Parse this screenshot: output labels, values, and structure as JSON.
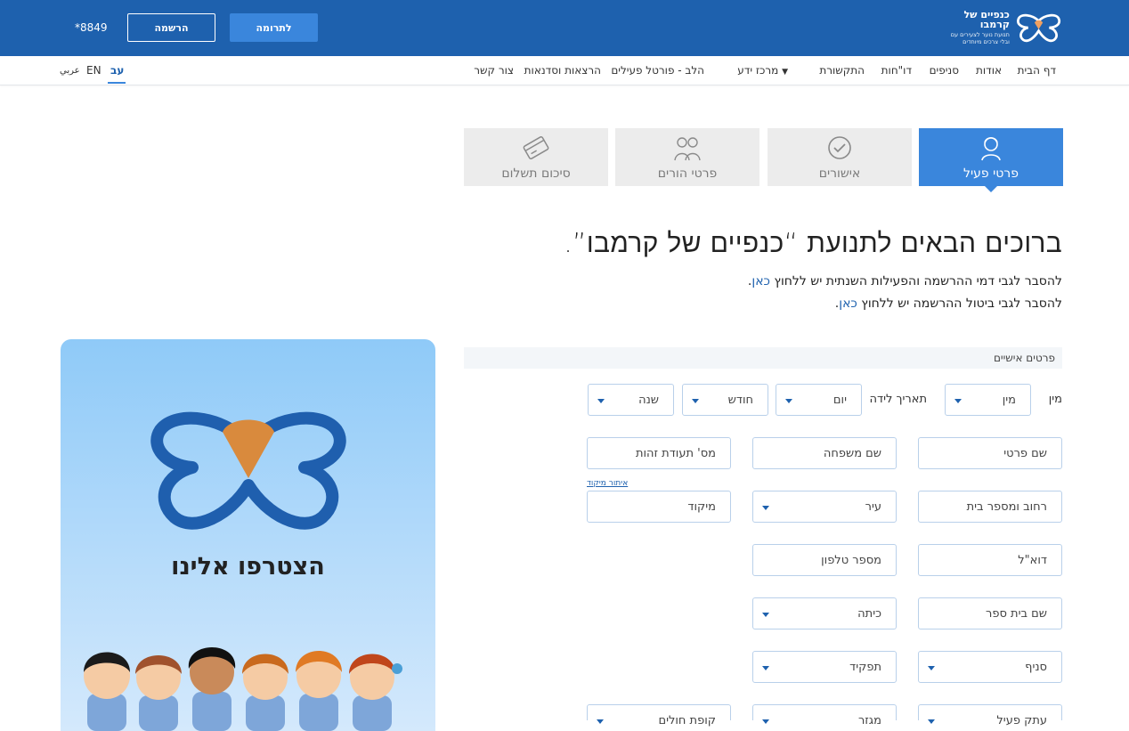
{
  "header": {
    "logo": {
      "name": "כנפיים של קרמבו",
      "tagline_1": "תנועת נוער לצעירים עם",
      "tagline_2": "ובלי צרכים מיוחדים"
    },
    "donate_label": "לתרומה",
    "register_label": "הרשמה",
    "phone": "*8849",
    "brand_color": "#1e61ae",
    "accent_color": "#3a86dc"
  },
  "nav": {
    "items": [
      "דף הבית",
      "אודות",
      "סניפים",
      "דו\"חות",
      "התקשורת",
      "מרכז ידע",
      "הלב - פורטל פעילים",
      "הרצאות וסדנאות",
      "צור קשר"
    ],
    "knowledge_caret": "▼",
    "languages": [
      "עב",
      "EN",
      "عربي"
    ]
  },
  "steps": [
    {
      "label": "פרטי פעיל",
      "icon": "person-icon",
      "active": true
    },
    {
      "label": "אישורים",
      "icon": "checkmark-icon",
      "active": false
    },
    {
      "label": "פרטי הורים",
      "icon": "parents-icon",
      "active": false
    },
    {
      "label": "סיכום תשלום",
      "icon": "credit-card-icon",
      "active": false
    }
  ],
  "welcome": {
    "title": "ברוכים הבאים לתנועת “כנפיים של קרמבו”.",
    "line1_text": "להסבר לגבי דמי ההרשמה והפעילות השנתית יש ללחוץ ",
    "line1_link": "כאן",
    "line2_text": "להסבר לגבי ביטול ההרשמה יש ללחוץ ",
    "line2_link": "כאן",
    "dot": "."
  },
  "panel": {
    "title": "הצטרפו אלינו"
  },
  "form": {
    "section_title": "פרטים אישיים",
    "gender_label": "מין",
    "gender_select": "מין",
    "birth_label": "תאריך לידה",
    "day": "יום",
    "month": "חודש",
    "year": "שנה",
    "first_name": "שם פרטי",
    "last_name": "שם משפחה",
    "id_number": "מס' תעודת זהות",
    "street": "רחוב ומספר בית",
    "city": "עיר",
    "zip": "מיקוד",
    "zip_lookup": "איתור מיקוד",
    "email": "דוא\"ל",
    "phone": "מספר טלפון",
    "school": "שם בית ספר",
    "grade": "כיתה",
    "branch": "סניף",
    "role": "תפקיד",
    "bottom_1": "עתק פעיל",
    "bottom_2": "מגזר",
    "bottom_3": "קופת חולים"
  }
}
